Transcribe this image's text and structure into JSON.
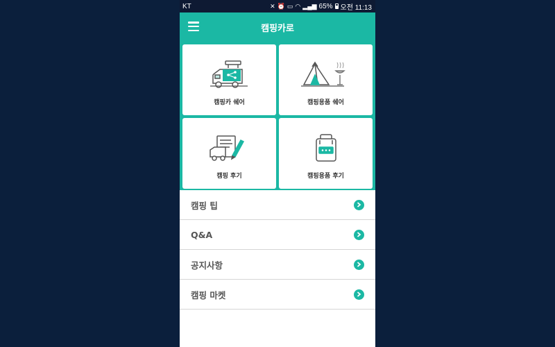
{
  "status_bar": {
    "carrier": "KT",
    "battery": "65%",
    "time": "오전 11:13"
  },
  "app_bar": {
    "title": "캠핑카로"
  },
  "tiles": [
    {
      "label": "캠핑카 쉐어",
      "icon": "camper-share-icon"
    },
    {
      "label": "캠핑용품 쉐어",
      "icon": "tent-grill-icon"
    },
    {
      "label": "캠핑 후기",
      "icon": "camper-review-icon"
    },
    {
      "label": "캠핑용품 후기",
      "icon": "backpack-review-icon"
    }
  ],
  "menu_list": [
    {
      "label": "캠핑 팁"
    },
    {
      "label": "Q&A"
    },
    {
      "label": "공지사항"
    },
    {
      "label": "캠핑 마켓"
    }
  ],
  "colors": {
    "accent": "#1bb8a4",
    "background": "#0b1f3c",
    "status_bar": "#0e1a33",
    "icon_dark": "#555555"
  }
}
